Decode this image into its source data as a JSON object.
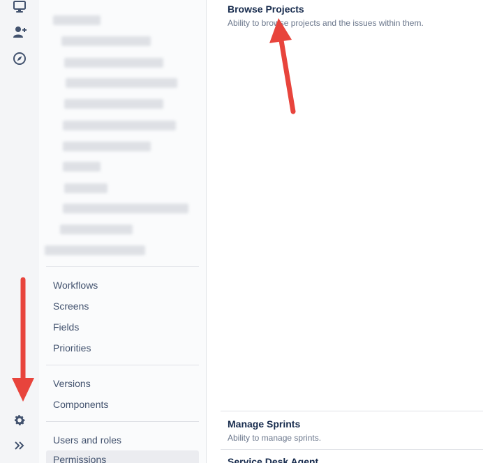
{
  "rail": {
    "icons": [
      "monitor-icon",
      "add-user-icon",
      "compass-icon",
      "gear-icon",
      "expand-chevrons-icon"
    ]
  },
  "sidebar": {
    "group_workflows": [
      "Workflows",
      "Screens",
      "Fields",
      "Priorities"
    ],
    "group_versions": [
      "Versions",
      "Components"
    ],
    "group_users": [
      "Users and roles",
      "Permissions"
    ],
    "active_item": "Permissions"
  },
  "permissions": [
    {
      "title": "Browse Projects",
      "description": "Ability to browse projects and the issues within them."
    },
    {
      "title": "Manage Sprints",
      "description": "Ability to manage sprints."
    },
    {
      "title": "Service Desk Agent",
      "description": ""
    }
  ],
  "colors": {
    "annotation_arrow": "#e8443c",
    "rail_bg": "#f4f5f7",
    "sidebar_bg": "#fafbfc",
    "text_primary": "#172b4d",
    "text_secondary": "#6b778c"
  }
}
